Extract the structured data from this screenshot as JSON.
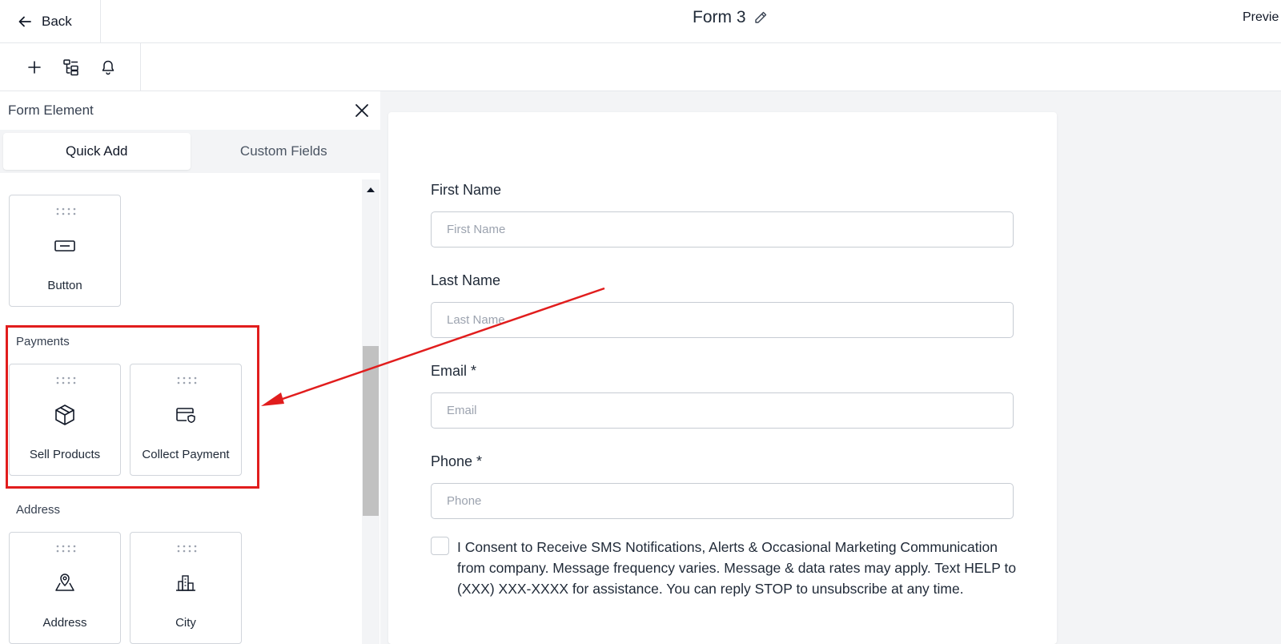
{
  "header": {
    "back_label": "Back",
    "form_title": "Form 3",
    "preview_label": "Previe"
  },
  "toolbar": {
    "icons": [
      "plus-icon",
      "form-layout-icon",
      "bell-icon"
    ]
  },
  "sidebar": {
    "title": "Form Element",
    "tabs": [
      {
        "label": "Quick Add",
        "active": true
      },
      {
        "label": "Custom Fields",
        "active": false
      }
    ],
    "elements": {
      "button": {
        "label": "Button",
        "icon": "button-icon"
      }
    },
    "sections": [
      {
        "title": "Payments",
        "items": [
          {
            "label": "Sell Products",
            "icon": "box-icon"
          },
          {
            "label": "Collect Payment",
            "icon": "card-payment-icon"
          }
        ]
      },
      {
        "title": "Address",
        "items": [
          {
            "label": "Address",
            "icon": "map-pin-icon"
          },
          {
            "label": "City",
            "icon": "city-icon"
          }
        ]
      }
    ]
  },
  "form": {
    "fields": [
      {
        "label": "First Name",
        "placeholder": "First Name",
        "value": ""
      },
      {
        "label": "Last Name",
        "placeholder": "Last Name",
        "value": ""
      },
      {
        "label": "Email *",
        "placeholder": "Email",
        "value": ""
      },
      {
        "label": "Phone *",
        "placeholder": "Phone",
        "value": ""
      }
    ],
    "consent_text": "I Consent to Receive SMS Notifications, Alerts & Occasional Marketing Communication from company. Message frequency varies. Message & data rates may apply. Text HELP to (XXX) XXX-XXXX for assistance. You can reply STOP to unsubscribe at any time.",
    "consent_checked": false
  },
  "annotation": {
    "highlight_color": "#e11d1d"
  }
}
